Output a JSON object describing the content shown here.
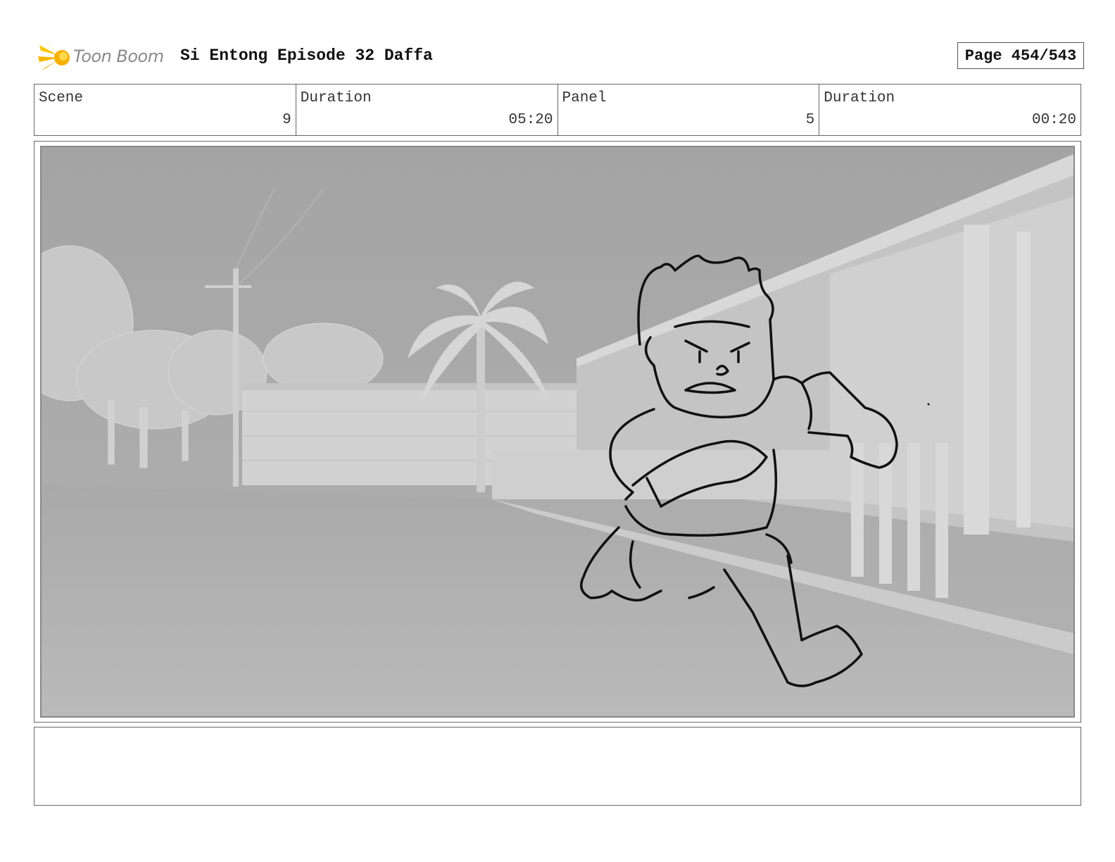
{
  "header": {
    "logo_text": "Toon Boom",
    "title": "Si Entong Episode 32 Daffa",
    "page_label": "Page 454/543"
  },
  "info": {
    "scene_label": "Scene",
    "scene_value": "9",
    "scene_duration_label": "Duration",
    "scene_duration_value": "05:20",
    "panel_label": "Panel",
    "panel_value": "5",
    "panel_duration_label": "Duration",
    "panel_duration_value": "00:20"
  },
  "panel": {
    "image_icon": "storyboard-sketch-running-boy"
  },
  "notes": {
    "text": ""
  },
  "colors": {
    "logo_accent": "#f5b800",
    "border": "#666666",
    "background_render": "#a8a8a8"
  }
}
